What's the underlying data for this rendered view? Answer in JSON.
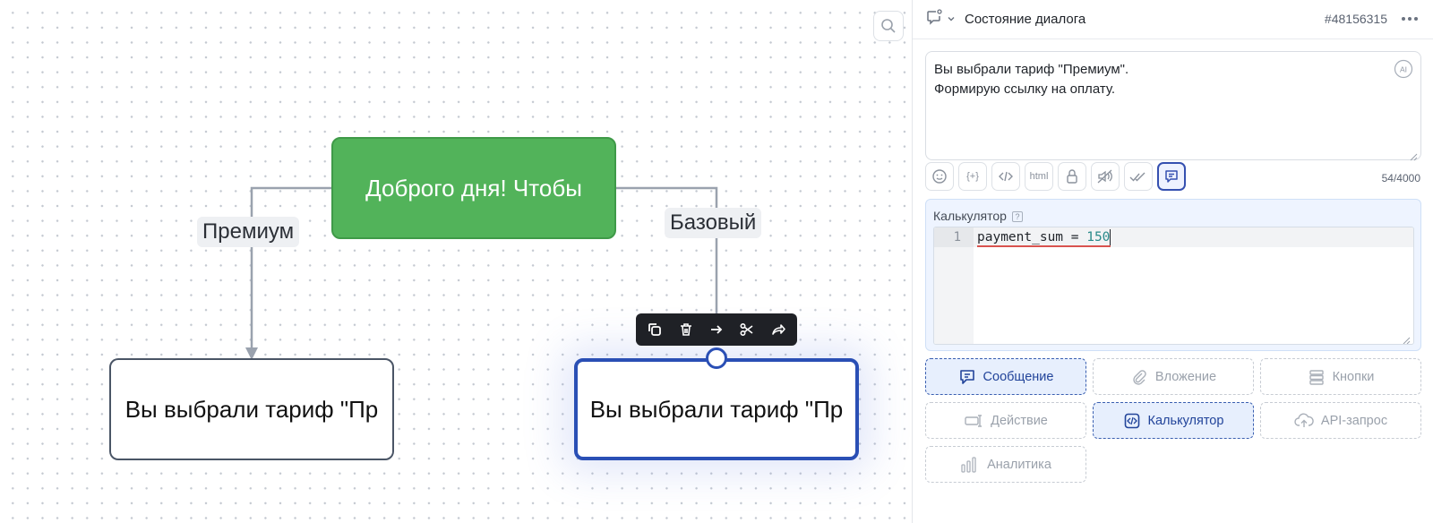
{
  "canvas": {
    "nodes": {
      "start": {
        "text": "Доброго дня!  Чтобы"
      },
      "premium_message": {
        "text": "Вы выбрали тариф \"Пр"
      },
      "basic_message": {
        "text": "Вы выбрали тариф \"Пр"
      }
    },
    "edges": {
      "premium": "Премиум",
      "basic": "Базовый"
    },
    "node_toolbar": [
      "copy-icon",
      "trash-icon",
      "arrow-right-icon",
      "scissors-icon",
      "share-icon"
    ],
    "search_icon": "search-icon"
  },
  "panel": {
    "header": {
      "title": "Состояние диалога",
      "id": "#48156315"
    },
    "message": {
      "lines": [
        "Вы выбрали тариф \"Премиум\".",
        "Формирую ссылку на оплату."
      ],
      "char_count": "54/4000"
    },
    "tools": [
      {
        "name": "emoji",
        "icon": "emoji-icon"
      },
      {
        "name": "variables",
        "icon": "braces-icon",
        "label": "{+}"
      },
      {
        "name": "code",
        "icon": "code-icon"
      },
      {
        "name": "html",
        "label": "html"
      },
      {
        "name": "lock",
        "icon": "lock-icon"
      },
      {
        "name": "mute",
        "icon": "muted-speaker-icon"
      },
      {
        "name": "read-receipt",
        "icon": "double-check-icon"
      },
      {
        "name": "message",
        "icon": "message-icon",
        "active": true
      }
    ],
    "calculator": {
      "label": "Калькулятор",
      "help": "?",
      "line_number": "1",
      "code_var": "payment_sum = ",
      "code_num": "150"
    },
    "blocks": [
      {
        "label": "Сообщение",
        "icon": "message-icon",
        "active": true
      },
      {
        "label": "Вложение",
        "icon": "attachment-icon",
        "active": false
      },
      {
        "label": "Кнопки",
        "icon": "buttons-icon",
        "active": false
      },
      {
        "label": "Действие",
        "icon": "action-icon",
        "active": false
      },
      {
        "label": "Калькулятор",
        "icon": "calculator-icon",
        "active": true
      },
      {
        "label": "API-запрос",
        "icon": "cloud-upload-icon",
        "active": false
      },
      {
        "label": "Аналитика",
        "icon": "analytics-icon",
        "active": false
      }
    ],
    "colors": {
      "accent": "#2a4fb5",
      "start_node": "#52b35a"
    }
  }
}
